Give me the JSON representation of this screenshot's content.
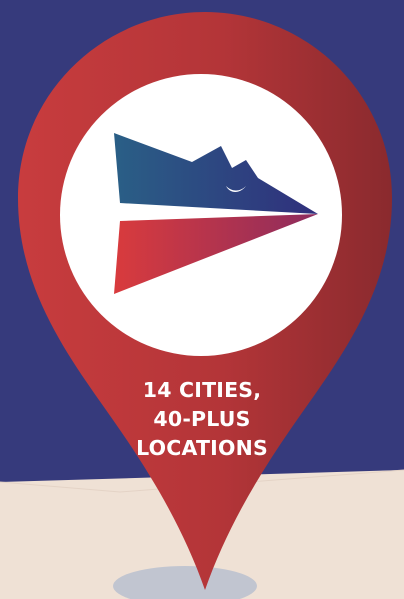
{
  "caption": {
    "line1": "14 CITIES,",
    "line2": "40-PLUS",
    "line3": "LOCATIONS"
  },
  "colors": {
    "background_blue": "#363a7c",
    "background_cream": "#efe1d5",
    "pin_red": "#c03a3c",
    "pin_dark_red": "#8a2a2e",
    "logo_blue": "#2b3a7d",
    "logo_red": "#d33a3c",
    "text": "#ffffff"
  },
  "icons": {
    "pin": "map-pin-icon",
    "logo": "paper-plane-logo-icon"
  }
}
